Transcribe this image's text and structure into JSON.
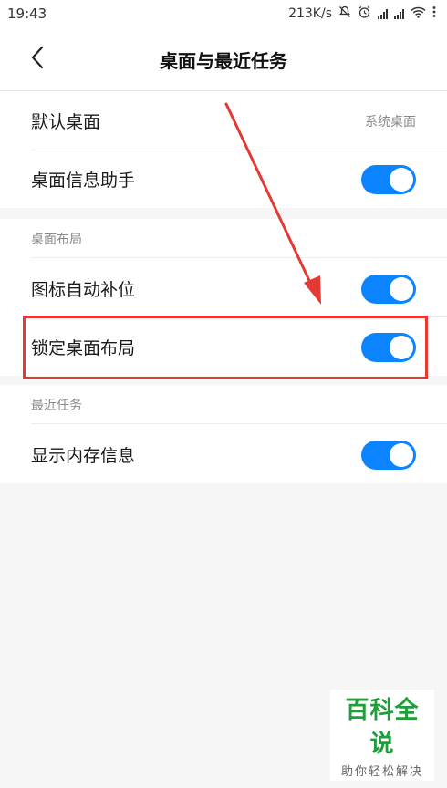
{
  "status_bar": {
    "time": "19:43",
    "speed": "213K/s"
  },
  "header": {
    "title": "桌面与最近任务"
  },
  "rows": {
    "default_launcher": {
      "label": "默认桌面",
      "value": "系统桌面"
    },
    "info_assistant": {
      "label": "桌面信息助手",
      "enabled": true
    }
  },
  "sections": {
    "layout": {
      "header": "桌面布局",
      "auto_fill": {
        "label": "图标自动补位",
        "enabled": true
      },
      "lock_layout": {
        "label": "锁定桌面布局",
        "enabled": true
      }
    },
    "recents": {
      "header": "最近任务",
      "show_memory": {
        "label": "显示内存信息",
        "enabled": true
      }
    }
  },
  "colors": {
    "toggle_on": "#0d84ff",
    "highlight": "#e53935",
    "watermark": "#1f9e3a"
  },
  "watermark": {
    "main": "百科全说",
    "sub": "助你轻松解决"
  }
}
